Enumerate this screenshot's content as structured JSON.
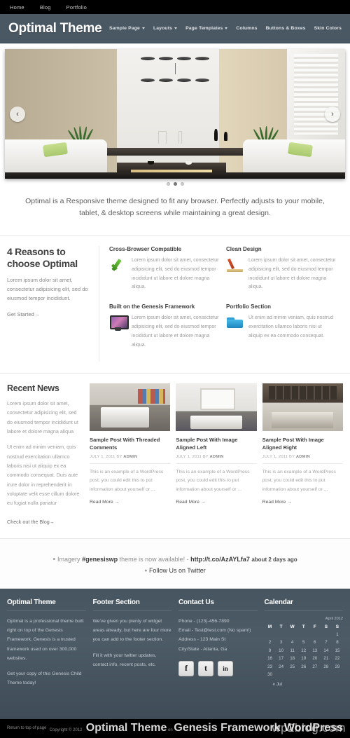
{
  "topbar": {
    "links": [
      {
        "label": "Home"
      },
      {
        "label": "Blog"
      },
      {
        "label": "Portfolio"
      }
    ]
  },
  "header": {
    "site_title": "Optimal Theme",
    "nav": [
      {
        "label": "Sample Page",
        "has_dropdown": true
      },
      {
        "label": "Layouts",
        "has_dropdown": true
      },
      {
        "label": "Page Templates",
        "has_dropdown": true
      },
      {
        "label": "Columns",
        "has_dropdown": false
      },
      {
        "label": "Buttons & Boxes",
        "has_dropdown": false
      },
      {
        "label": "Skin Colors",
        "has_dropdown": false
      }
    ]
  },
  "hero": {
    "prev_label": "‹",
    "next_label": "›",
    "dots": [
      {
        "active": false
      },
      {
        "active": true
      },
      {
        "active": false
      }
    ]
  },
  "tagline": {
    "text": "Optimal is a Responsive theme designed to fit any browser. Perfectly adjusts to your mobile, tablet, & desktop screens while maintaining a great design."
  },
  "features": {
    "heading": "4 Reasons to choose Optimal",
    "intro": "Lorem ipsum dolor sit amet, consectetur adipisicing elit, sed do eiusmod tempor incididunt.",
    "cta": "Get Started→",
    "boxes": [
      {
        "title": "Cross-Browser Compatible",
        "icon": "check-icon",
        "text": "Lorem ipsum dolor sit amet, consectetur adipisicing elit, sed do eiusmod tempor incididunt ut labore et dolore magna aliqua."
      },
      {
        "title": "Clean Design",
        "icon": "design-icon",
        "text": "Lorem ipsum dolor sit amet, consectetur adipisicing elit, sed do eiusmod tempor incididunt ut labore et dolore magna aliqua."
      },
      {
        "title": "Built on the Genesis Framework",
        "icon": "monitor-icon",
        "text": "Lorem ipsum dolor sit amet, consectetur adipisicing elit, sed do eiusmod tempor incididunt ut labore et dolore magna aliqua."
      },
      {
        "title": "Portfolio Section",
        "icon": "folder-icon",
        "text": "Ut enim ad minim veniam, quis nostrud exercitation ullamco laboris nisi ut aliquip ex ea commodo consequat."
      }
    ]
  },
  "news": {
    "heading": "Recent News",
    "para1": "Lorem ipsum dolor sit amet, consectetur adipisicing elit, sed do eiusmod tempor incididunt ut labore et dolore magna aliqua",
    "para2": "Ut enim ad minim veniam, quis nostrud exercitation ullamco laboris nisi ut aliquip ex ea commodo consequat. Duis aute irure dolor in reprehenderit in voluptate velit esse cillum dolore eu fugiat nulla pariatur",
    "cta": "Check out the Blog→",
    "posts": [
      {
        "title": "Sample Post With Threaded Comments",
        "date": "JULY 1, 2011 BY",
        "author": "ADMIN",
        "excerpt": "This is an example of a WordPress post, you could edit this to put information about yourself or ...",
        "read_more": "Read More →"
      },
      {
        "title": "Sample Post With Image Aligned Left",
        "date": "JULY 1, 2011 BY",
        "author": "ADMIN",
        "excerpt": "This is an example of a WordPress post, you could edit this to put information about yourself or ...",
        "read_more": "Read More →"
      },
      {
        "title": "Sample Post With Image Aligned Right",
        "date": "JULY 1, 2011 BY",
        "author": "ADMIN",
        "excerpt": "This is an example of a WordPress post, you could edit this to put information about yourself or ...",
        "read_more": "Read More →"
      }
    ]
  },
  "twitter": {
    "tweet_start": "Imagery ",
    "hashtag": "#genesiswp",
    "tweet_mid": " theme is now available! - ",
    "url": "http://t.co/AzAYLfa7",
    "ago": "about 2 days ago",
    "follow": "Follow Us on Twitter"
  },
  "footer": {
    "widgets": [
      {
        "title": "Optimal Theme",
        "paragraphs": [
          "Optimal is a professional theme built right on top of the Genesis Framework. Genesis is a trusted framework used on over 300,000 websites.",
          "Get your copy of this Genesis Child Theme today!"
        ]
      },
      {
        "title": "Footer Section",
        "paragraphs": [
          "We've given you plenty of widget areas already, but here are four more you can add to the footer section.",
          "Fill it with your twitter updates, contact info, recent posts, etc."
        ]
      }
    ],
    "contact": {
      "title": "Contact Us",
      "lines": [
        "Phone - (123)-456-7890",
        "Email - Test@test.com (No spam!)",
        "Address - 123 Main St",
        "City/State - Atlanta, Ga"
      ],
      "socials": [
        {
          "name": "facebook-icon",
          "glyph": "f"
        },
        {
          "name": "twitter-icon",
          "glyph": "t"
        },
        {
          "name": "linkedin-icon",
          "glyph": "in"
        }
      ]
    },
    "calendar": {
      "title": "Calendar",
      "caption": "April 2012",
      "weekdays": [
        "M",
        "T",
        "W",
        "T",
        "F",
        "S",
        "S"
      ],
      "weeks": [
        [
          "",
          "",
          "",
          "",
          "",
          "",
          "1"
        ],
        [
          "2",
          "3",
          "4",
          "5",
          "6",
          "7",
          "8"
        ],
        [
          "9",
          "10",
          "11",
          "12",
          "13",
          "14",
          "15"
        ],
        [
          "16",
          "17",
          "18",
          "19",
          "20",
          "21",
          "22"
        ],
        [
          "23",
          "24",
          "25",
          "26",
          "27",
          "28",
          "29"
        ],
        [
          "30",
          "",
          "",
          "",
          "",
          "",
          ""
        ]
      ],
      "prev_link": "« Jul"
    }
  },
  "bottombar": {
    "return_top": "Return to top of page",
    "copyright": "Copyright © 2012 · ",
    "theme": "Optimal Theme",
    "on": " on ",
    "framework": "Genesis Framework",
    "sep": " · ",
    "platform": "WordPress",
    "watermark": "wp2blog.com"
  }
}
